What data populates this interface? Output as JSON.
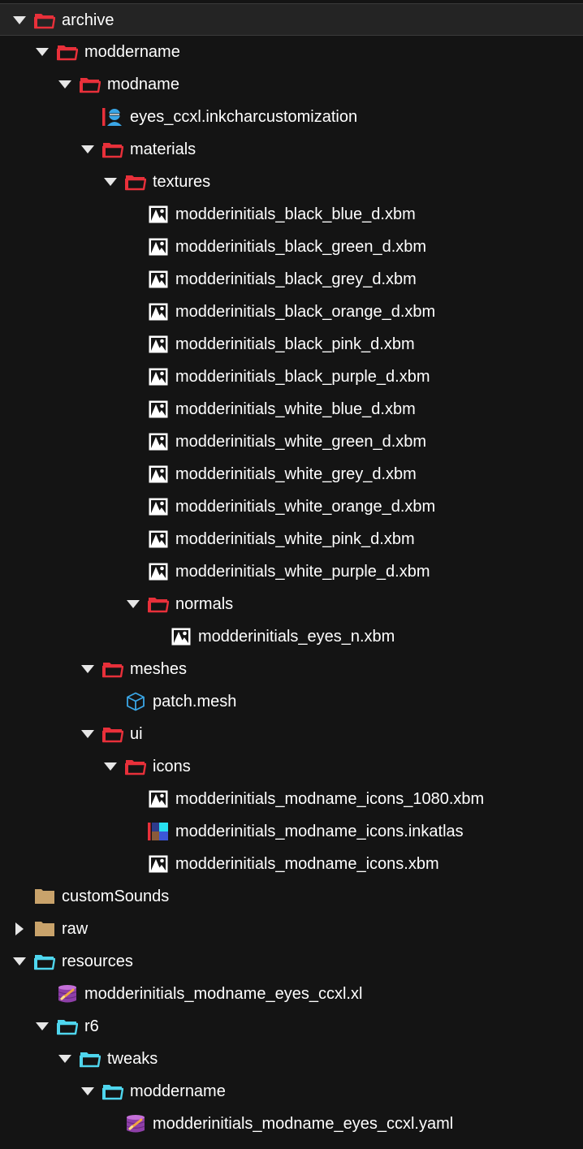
{
  "colors": {
    "background": "#141414",
    "selected_row": "#242424",
    "folder_red": "#e8303a",
    "folder_tan": "#c9a36b",
    "folder_cyan": "#4fd6ee",
    "text": "#ffffff"
  },
  "tree": [
    {
      "label": "archive",
      "depth": 0,
      "state": "expanded",
      "icon": "folder-open-red-icon",
      "selected": true
    },
    {
      "label": "moddername",
      "depth": 1,
      "state": "expanded",
      "icon": "folder-open-red-icon"
    },
    {
      "label": "modname",
      "depth": 2,
      "state": "expanded",
      "icon": "folder-open-red-icon"
    },
    {
      "label": "eyes_ccxl.inkcharcustomization",
      "depth": 3,
      "state": "leaf",
      "icon": "character-customization-icon"
    },
    {
      "label": "materials",
      "depth": 3,
      "state": "expanded",
      "icon": "folder-open-red-icon"
    },
    {
      "label": "textures",
      "depth": 4,
      "state": "expanded",
      "icon": "folder-open-red-icon"
    },
    {
      "label": "modderinitials_black_blue_d.xbm",
      "depth": 5,
      "state": "leaf",
      "icon": "image-file-icon"
    },
    {
      "label": "modderinitials_black_green_d.xbm",
      "depth": 5,
      "state": "leaf",
      "icon": "image-file-icon"
    },
    {
      "label": "modderinitials_black_grey_d.xbm",
      "depth": 5,
      "state": "leaf",
      "icon": "image-file-icon"
    },
    {
      "label": "modderinitials_black_orange_d.xbm",
      "depth": 5,
      "state": "leaf",
      "icon": "image-file-icon"
    },
    {
      "label": "modderinitials_black_pink_d.xbm",
      "depth": 5,
      "state": "leaf",
      "icon": "image-file-icon"
    },
    {
      "label": "modderinitials_black_purple_d.xbm",
      "depth": 5,
      "state": "leaf",
      "icon": "image-file-icon"
    },
    {
      "label": "modderinitials_white_blue_d.xbm",
      "depth": 5,
      "state": "leaf",
      "icon": "image-file-icon"
    },
    {
      "label": "modderinitials_white_green_d.xbm",
      "depth": 5,
      "state": "leaf",
      "icon": "image-file-icon"
    },
    {
      "label": "modderinitials_white_grey_d.xbm",
      "depth": 5,
      "state": "leaf",
      "icon": "image-file-icon"
    },
    {
      "label": "modderinitials_white_orange_d.xbm",
      "depth": 5,
      "state": "leaf",
      "icon": "image-file-icon"
    },
    {
      "label": "modderinitials_white_pink_d.xbm",
      "depth": 5,
      "state": "leaf",
      "icon": "image-file-icon"
    },
    {
      "label": "modderinitials_white_purple_d.xbm",
      "depth": 5,
      "state": "leaf",
      "icon": "image-file-icon"
    },
    {
      "label": "normals",
      "depth": 5,
      "state": "expanded",
      "icon": "folder-open-red-icon"
    },
    {
      "label": "modderinitials_eyes_n.xbm",
      "depth": 6,
      "state": "leaf",
      "icon": "image-file-icon"
    },
    {
      "label": "meshes",
      "depth": 3,
      "state": "expanded",
      "icon": "folder-open-red-icon"
    },
    {
      "label": "patch.mesh",
      "depth": 4,
      "state": "leaf",
      "icon": "mesh-cube-icon"
    },
    {
      "label": "ui",
      "depth": 3,
      "state": "expanded",
      "icon": "folder-open-red-icon"
    },
    {
      "label": "icons",
      "depth": 4,
      "state": "expanded",
      "icon": "folder-open-red-icon"
    },
    {
      "label": "modderinitials_modname_icons_1080.xbm",
      "depth": 5,
      "state": "leaf",
      "icon": "image-file-icon"
    },
    {
      "label": "modderinitials_modname_icons.inkatlas",
      "depth": 5,
      "state": "leaf",
      "icon": "ink-atlas-icon"
    },
    {
      "label": "modderinitials_modname_icons.xbm",
      "depth": 5,
      "state": "leaf",
      "icon": "image-file-icon"
    },
    {
      "label": "customSounds",
      "depth": 0,
      "state": "leaf",
      "icon": "folder-closed-tan-icon"
    },
    {
      "label": "raw",
      "depth": 0,
      "state": "collapsed",
      "icon": "folder-closed-tan-icon"
    },
    {
      "label": "resources",
      "depth": 0,
      "state": "expanded",
      "icon": "folder-open-cyan-icon"
    },
    {
      "label": "modderinitials_modname_eyes_ccxl.xl",
      "depth": 1,
      "state": "leaf",
      "icon": "database-file-icon"
    },
    {
      "label": "r6",
      "depth": 1,
      "state": "expanded",
      "icon": "folder-open-cyan-icon"
    },
    {
      "label": "tweaks",
      "depth": 2,
      "state": "expanded",
      "icon": "folder-open-cyan-icon"
    },
    {
      "label": "moddername",
      "depth": 3,
      "state": "expanded",
      "icon": "folder-open-cyan-icon"
    },
    {
      "label": "modderinitials_modname_eyes_ccxl.yaml",
      "depth": 4,
      "state": "leaf",
      "icon": "database-file-icon"
    }
  ]
}
